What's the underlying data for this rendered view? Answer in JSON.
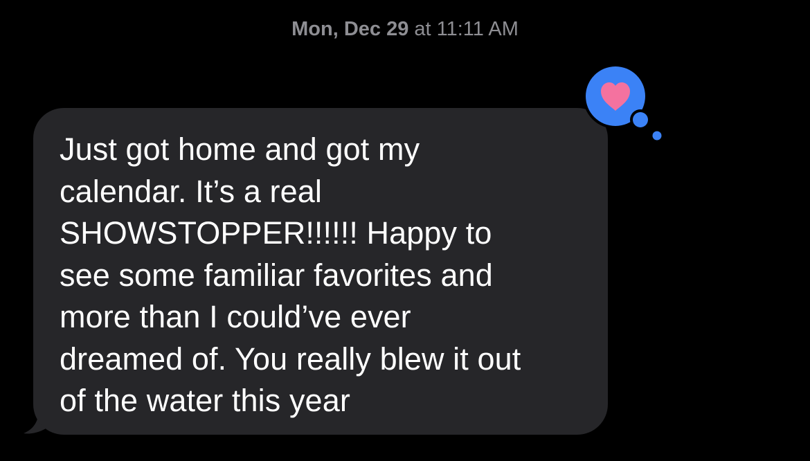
{
  "conversation": {
    "timestamp": {
      "day_date": "Mon, Dec 29",
      "time": "at 11:11 AM"
    },
    "messages": [
      {
        "direction": "incoming",
        "text": "Just got home and got my\ncalendar. It’s a real\nSHOWSTOPPER!!!!!! Happy to\nsee some familiar favorites and\nmore than I could’ve ever\ndreamed of. You really blew it out\nof the water this year",
        "reaction": {
          "icon": "heart-icon",
          "reaction_color": "#3b82f6",
          "heart_color": "#f4729f"
        }
      }
    ]
  },
  "colors": {
    "background": "#000000",
    "bubble": "#262629",
    "text": "#ffffff",
    "timestamp": "#8e8e93"
  }
}
